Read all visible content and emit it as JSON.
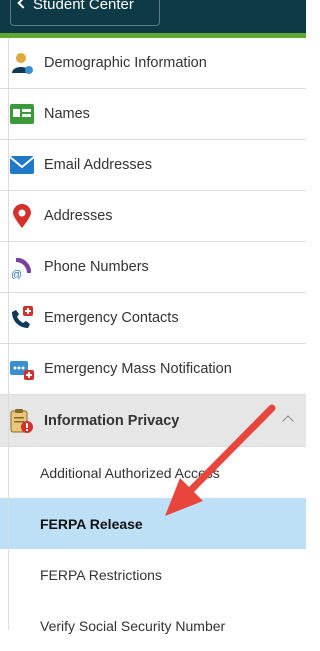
{
  "header": {
    "back_label": "Student Center"
  },
  "menu": {
    "items": [
      {
        "label": "Demographic Information",
        "icon": "person-icon"
      },
      {
        "label": "Names",
        "icon": "id-card-icon"
      },
      {
        "label": "Email Addresses",
        "icon": "envelope-icon"
      },
      {
        "label": "Addresses",
        "icon": "map-pin-icon"
      },
      {
        "label": "Phone Numbers",
        "icon": "phone-icon"
      },
      {
        "label": "Emergency Contacts",
        "icon": "emergency-phone-icon"
      },
      {
        "label": "Emergency Mass Notification",
        "icon": "notification-icon"
      }
    ],
    "section": {
      "label": "Information Privacy",
      "icon": "clipboard-alert-icon",
      "expanded": true
    },
    "subitems": [
      {
        "label": "Additional Authorized Access"
      },
      {
        "label": "FERPA Release",
        "selected": true
      },
      {
        "label": "FERPA Restrictions"
      },
      {
        "label": "Verify Social Security Number"
      }
    ]
  },
  "colors": {
    "header_bg": "#0e3a47",
    "accent_green": "#5fa834",
    "selected_bg": "#bde0f6",
    "arrow": "#e8463c"
  }
}
